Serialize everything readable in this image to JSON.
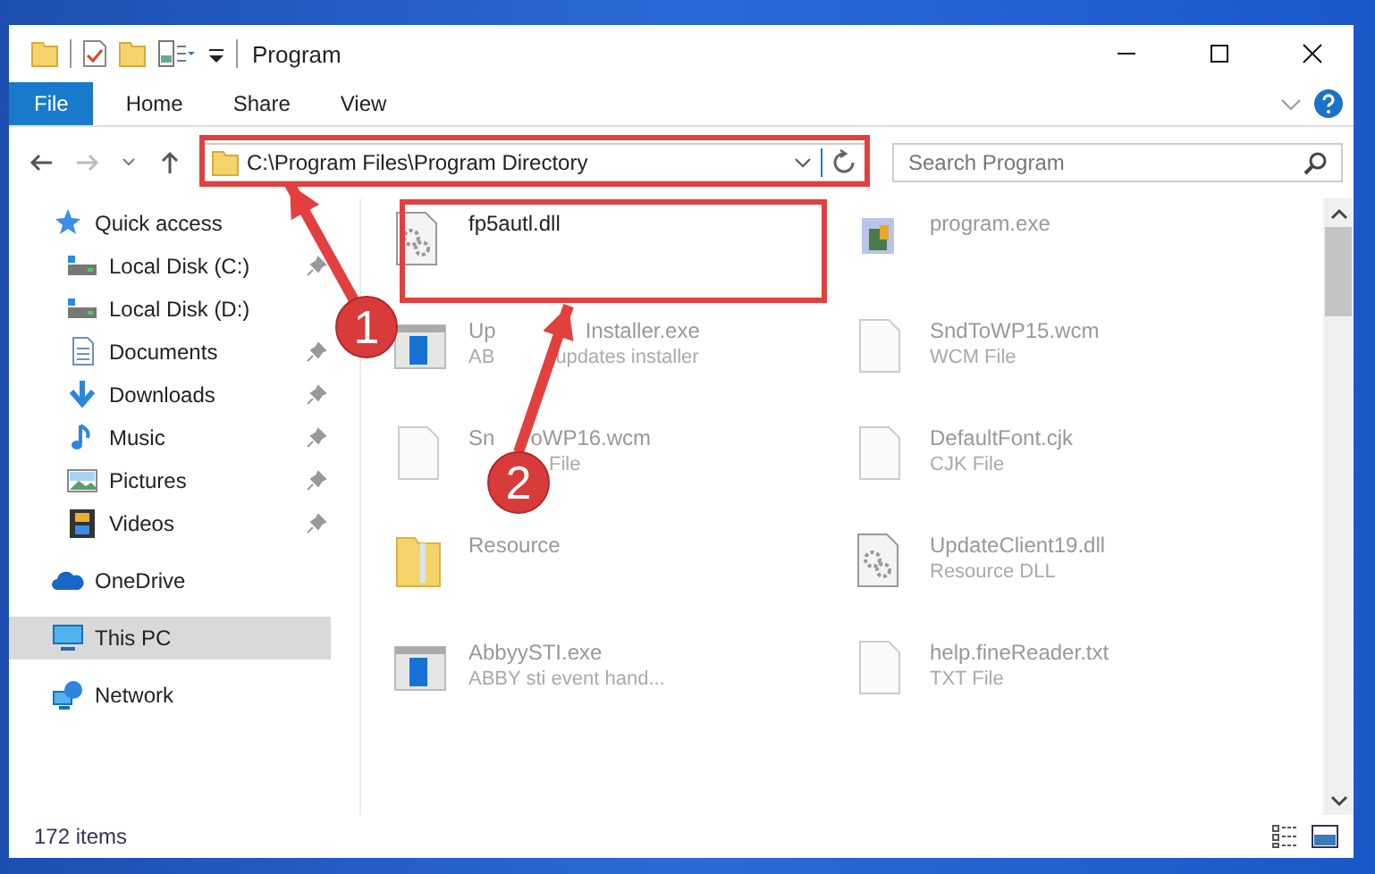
{
  "window": {
    "title": "Program"
  },
  "ribbon_tabs": [
    {
      "label": "File",
      "selected": true
    },
    {
      "label": "Home",
      "selected": false
    },
    {
      "label": "Share",
      "selected": false
    },
    {
      "label": "View",
      "selected": false
    }
  ],
  "address_bar": {
    "path": "C:\\Program Files\\Program Directory"
  },
  "search": {
    "placeholder": "Search Program"
  },
  "sidebar": {
    "items": [
      {
        "label": "Quick access",
        "kind": "star",
        "selected": false,
        "children": [
          {
            "label": "Local Disk (C:)",
            "kind": "disk",
            "pinned": true
          },
          {
            "label": "Local Disk (D:)",
            "kind": "disk",
            "pinned": false
          },
          {
            "label": "Documents",
            "kind": "document",
            "pinned": true
          },
          {
            "label": "Downloads",
            "kind": "download",
            "pinned": true
          },
          {
            "label": "Music",
            "kind": "music",
            "pinned": true
          },
          {
            "label": "Pictures",
            "kind": "pictures",
            "pinned": true
          },
          {
            "label": "Videos",
            "kind": "videos",
            "pinned": true
          }
        ]
      },
      {
        "label": "OneDrive",
        "kind": "cloud",
        "selected": false
      },
      {
        "label": "This PC",
        "kind": "pc",
        "selected": true
      },
      {
        "label": "Network",
        "kind": "network",
        "selected": false
      }
    ]
  },
  "files": [
    {
      "name": "fp5autl.dll",
      "kind": "gears",
      "highlighted": true
    },
    {
      "name": "program.exe",
      "kind": "setup",
      "highlighted": false
    },
    {
      "name": [
        "Up",
        "Installer.exe"
      ],
      "type": [
        "AB",
        "updates installer"
      ],
      "kind": "app",
      "highlighted": false
    },
    {
      "name": "SndToWP15.wcm",
      "type": "WCM File",
      "kind": "blank",
      "highlighted": false
    },
    {
      "name": [
        "Sn",
        "oWP16.wcm"
      ],
      "type": [
        "File"
      ],
      "kind": "blank",
      "highlighted": false
    },
    {
      "name": "DefaultFont.cjk",
      "type": "CJK File",
      "kind": "blank",
      "highlighted": false
    },
    {
      "name": "Resource",
      "kind": "folder",
      "highlighted": false
    },
    {
      "name": "UpdateClient19.dll",
      "type": "Resource DLL",
      "kind": "gears",
      "highlighted": false
    },
    {
      "name": "AbbyySTI.exe",
      "type": "ABBY sti event hand...",
      "kind": "app",
      "highlighted": false
    },
    {
      "name": "help.fineReader.txt",
      "type": "TXT File",
      "kind": "blank",
      "highlighted": false
    }
  ],
  "callouts": [
    {
      "number": "1"
    },
    {
      "number": "2"
    }
  ],
  "status_bar": {
    "item_count": "172 items"
  }
}
